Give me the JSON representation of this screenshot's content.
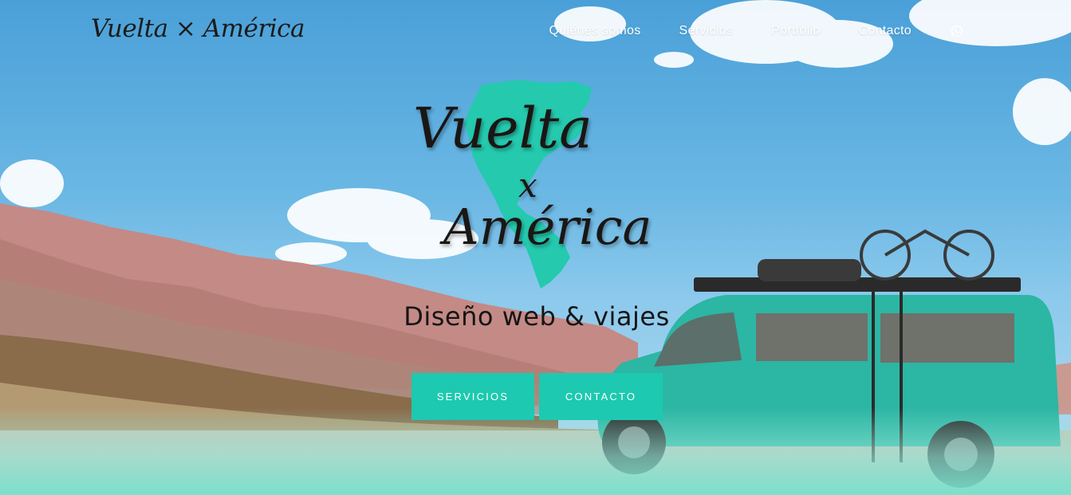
{
  "brand": {
    "name": "Vuelta × América"
  },
  "nav": {
    "items": [
      {
        "label": "Quiénes somos"
      },
      {
        "label": "Servicios"
      },
      {
        "label": "Portfolio"
      },
      {
        "label": "Contacto"
      }
    ],
    "whatsapp_icon": "whatsapp-icon"
  },
  "hero": {
    "logo_line1": "Vuelta",
    "logo_line2": "x",
    "logo_line3": "América",
    "tagline": "Diseño web & viajes",
    "buttons": {
      "services": "SERVICIOS",
      "contact": "CONTACTO"
    }
  },
  "colors": {
    "accent": "#1dc9b0",
    "text_dark": "#151515",
    "nav_text": "#ffffff",
    "map_teal": "#25c9ae"
  }
}
